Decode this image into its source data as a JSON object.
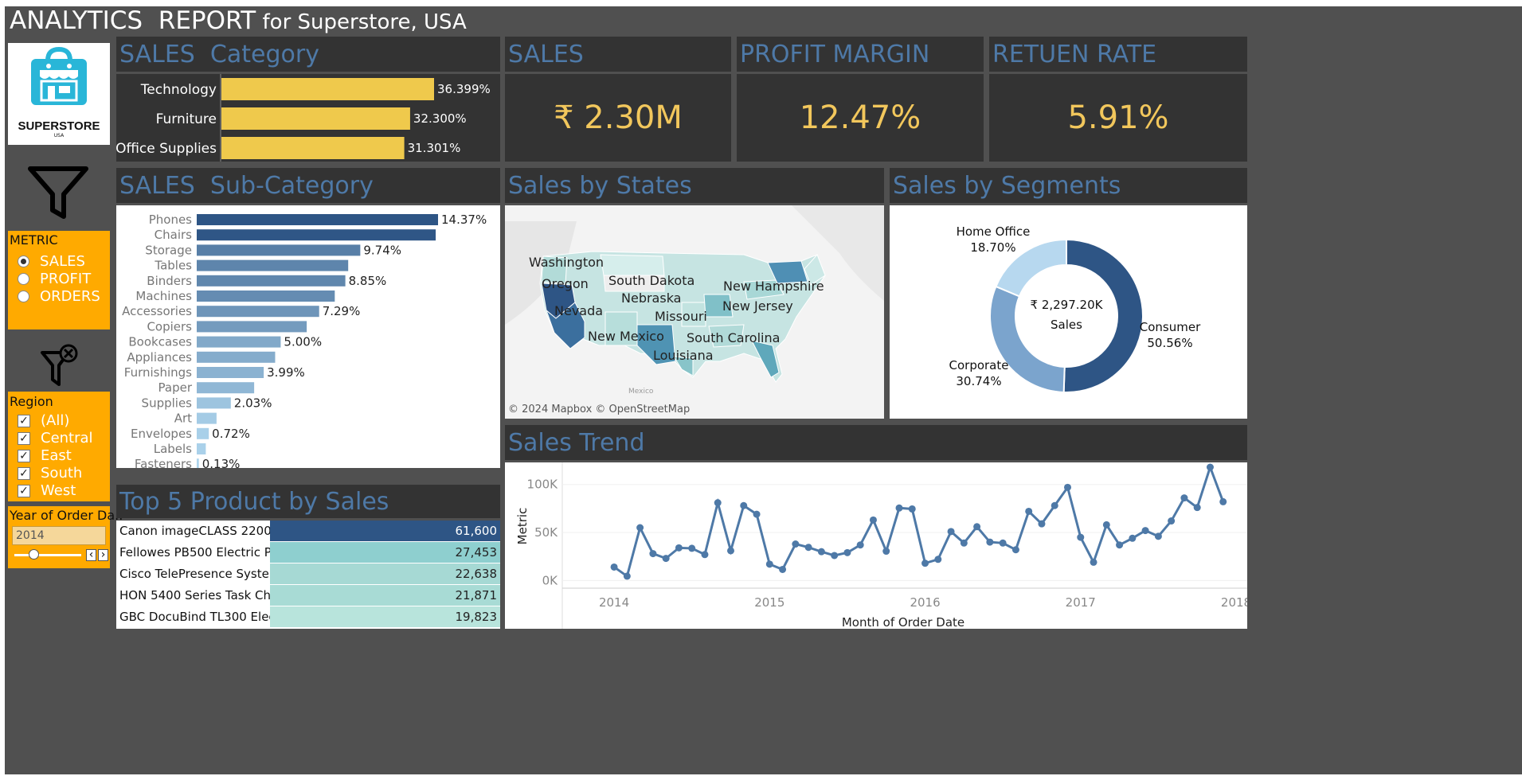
{
  "title": {
    "main": "ANALYTICS  REPORT",
    "sub": " for Superstore, USA"
  },
  "logo": {
    "name": "SUPERSTORE",
    "sub": "USA"
  },
  "metric_filter": {
    "title": "METRIC",
    "options": [
      "SALES",
      "PROFIT",
      "ORDERS"
    ],
    "selected": "SALES"
  },
  "region_filter": {
    "title": "Region",
    "options": [
      "(All)",
      "Central",
      "East",
      "South",
      "West"
    ]
  },
  "year_filter": {
    "title": "Year of Order Da..",
    "value": "2014",
    "prev_icon": "‹",
    "next_icon": "›"
  },
  "category": {
    "title": "SALES  Category",
    "items": [
      {
        "label": "Technology",
        "value": 36.399,
        "display": "36.399%"
      },
      {
        "label": "Furniture",
        "value": 32.3,
        "display": "32.300%"
      },
      {
        "label": "Office Supplies",
        "value": 31.301,
        "display": "31.301%"
      }
    ],
    "bar_color": "#efc94c"
  },
  "kpis": {
    "sales": {
      "title": "SALES",
      "value": "₹ 2.30M"
    },
    "profit_margin": {
      "title": "PROFIT MARGIN",
      "value": "12.47%"
    },
    "return_rate": {
      "title": "RETUEN RATE",
      "value": "5.91%"
    }
  },
  "subcategory": {
    "title": "SALES  Sub-Category",
    "items": [
      {
        "label": "Phones",
        "value": 14.37,
        "display": "14.37%"
      },
      {
        "label": "Chairs",
        "value": 14.23,
        "display": ""
      },
      {
        "label": "Storage",
        "value": 9.74,
        "display": "9.74%"
      },
      {
        "label": "Tables",
        "value": 9.02,
        "display": ""
      },
      {
        "label": "Binders",
        "value": 8.85,
        "display": "8.85%"
      },
      {
        "label": "Machines",
        "value": 8.22,
        "display": ""
      },
      {
        "label": "Accessories",
        "value": 7.29,
        "display": "7.29%"
      },
      {
        "label": "Copiers",
        "value": 6.55,
        "display": ""
      },
      {
        "label": "Bookcases",
        "value": 5.0,
        "display": "5.00%"
      },
      {
        "label": "Appliances",
        "value": 4.67,
        "display": ""
      },
      {
        "label": "Furnishings",
        "value": 3.99,
        "display": "3.99%"
      },
      {
        "label": "Paper",
        "value": 3.42,
        "display": ""
      },
      {
        "label": "Supplies",
        "value": 2.03,
        "display": "2.03%"
      },
      {
        "label": "Art",
        "value": 1.18,
        "display": ""
      },
      {
        "label": "Envelopes",
        "value": 0.72,
        "display": "0.72%"
      },
      {
        "label": "Labels",
        "value": 0.54,
        "display": ""
      },
      {
        "label": "Fasteners",
        "value": 0.13,
        "display": "0.13%"
      }
    ]
  },
  "map": {
    "title": "Sales by States",
    "labels": [
      "Washington",
      "Oregon",
      "South Dakota",
      "New Hampshire",
      "Nebraska",
      "New Jersey",
      "Nevada",
      "Missouri",
      "New Mexico",
      "South Carolina",
      "Louisiana"
    ],
    "mexico_label": "Mexico",
    "attribution": "© 2024 Mapbox © OpenStreetMap"
  },
  "segments": {
    "title": "Sales by Segments",
    "center_value": "₹ 2,297.20K",
    "center_label": "Sales",
    "items": [
      {
        "name": "Consumer",
        "value": 50.56,
        "display": "50.56%",
        "color": "#2e5585"
      },
      {
        "name": "Corporate",
        "value": 30.74,
        "display": "30.74%",
        "color": "#7ba4cd"
      },
      {
        "name": "Home Office",
        "value": 18.7,
        "display": "18.70%",
        "color": "#b7d8ef"
      }
    ]
  },
  "top5": {
    "title": "Top 5 Product by Sales",
    "items": [
      {
        "name": "Canon imageCLASS 2200 ..",
        "value": "61,600",
        "color": "#2e5585"
      },
      {
        "name": "Fellowes PB500 Electric P..",
        "value": "27,453",
        "color": "#8ecfcf"
      },
      {
        "name": "Cisco TelePresence Syste..",
        "value": "22,638",
        "color": "#a6d9d4"
      },
      {
        "name": "HON 5400 Series Task Ch..",
        "value": "21,871",
        "color": "#a8dbd5"
      },
      {
        "name": "GBC DocuBind TL300 Elec..",
        "value": "19,823",
        "color": "#b8e4dc"
      }
    ]
  },
  "chart_data": {
    "type": "line",
    "title": "Sales Trend",
    "xlabel": "Month of Order Date",
    "ylabel": "Metric",
    "y_ticks": [
      "0K",
      "50K",
      "100K"
    ],
    "x_ticks": [
      "2014",
      "2015",
      "2016",
      "2017",
      "2018"
    ],
    "ylim": [
      -8000,
      118000
    ],
    "xlim": [
      "2013-09",
      "2018-01"
    ],
    "series": [
      {
        "color": "#4e79a7",
        "x": [
          "2014-01",
          "2014-02",
          "2014-03",
          "2014-04",
          "2014-05",
          "2014-06",
          "2014-07",
          "2014-08",
          "2014-09",
          "2014-10",
          "2014-11",
          "2014-12",
          "2015-01",
          "2015-02",
          "2015-03",
          "2015-04",
          "2015-05",
          "2015-06",
          "2015-07",
          "2015-08",
          "2015-09",
          "2015-10",
          "2015-11",
          "2015-12",
          "2016-01",
          "2016-02",
          "2016-03",
          "2016-04",
          "2016-05",
          "2016-06",
          "2016-07",
          "2016-08",
          "2016-09",
          "2016-10",
          "2016-11",
          "2016-12",
          "2017-01",
          "2017-02",
          "2017-03",
          "2017-04",
          "2017-05",
          "2017-06",
          "2017-07",
          "2017-08",
          "2017-09",
          "2017-10",
          "2017-11",
          "2017-12"
        ],
        "values": [
          14000,
          4500,
          55000,
          28000,
          23000,
          34000,
          33500,
          27000,
          81000,
          31000,
          78000,
          69000,
          17000,
          11500,
          38000,
          34500,
          30000,
          26000,
          29000,
          37000,
          63000,
          30500,
          75500,
          74500,
          18000,
          22000,
          51000,
          39000,
          56000,
          40000,
          39000,
          32000,
          72000,
          59000,
          78000,
          97000,
          45000,
          19000,
          58000,
          37000,
          44000,
          52000,
          46000,
          62000,
          86000,
          76000,
          118000,
          82000
        ]
      }
    ]
  }
}
